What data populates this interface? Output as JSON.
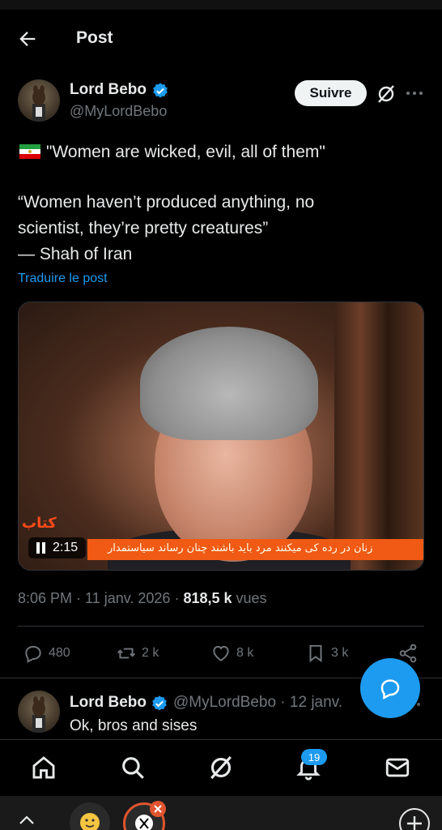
{
  "header": {
    "title": "Post"
  },
  "author": {
    "name": "Lord Bebo",
    "handle": "@MyLordBebo",
    "follow_label": "Suivre"
  },
  "post": {
    "lines": [
      "\"Women are wicked, evil, all of them\"",
      "“Women haven’t produced anything, no",
      "scientist, they’re pretty creatures”",
      "— Shah of Iran"
    ],
    "translate_label": "Traduire le post",
    "video": {
      "duration": "2:15",
      "banner_text": "زنان در رده کی میکنند مرد باید باشند چنان رساند سیاستمدار",
      "channel_logo": "کتاب"
    },
    "time": "8:06 PM · 11 janv. 2026 · ",
    "views_count": "818,5 k",
    "views_label": " vues"
  },
  "actions": {
    "replies": "480",
    "reposts": "2 k",
    "likes": "8 k",
    "bookmarks": "3 k"
  },
  "reply": {
    "name": "Lord Bebo",
    "handle_date": "@MyLordBebo · 12 janv.",
    "text": "Ok, bros and sises"
  },
  "nav": {
    "notifications_badge": "19"
  },
  "colors": {
    "accent": "#1d9bf0",
    "background": "#000000",
    "muted": "#71767b"
  }
}
